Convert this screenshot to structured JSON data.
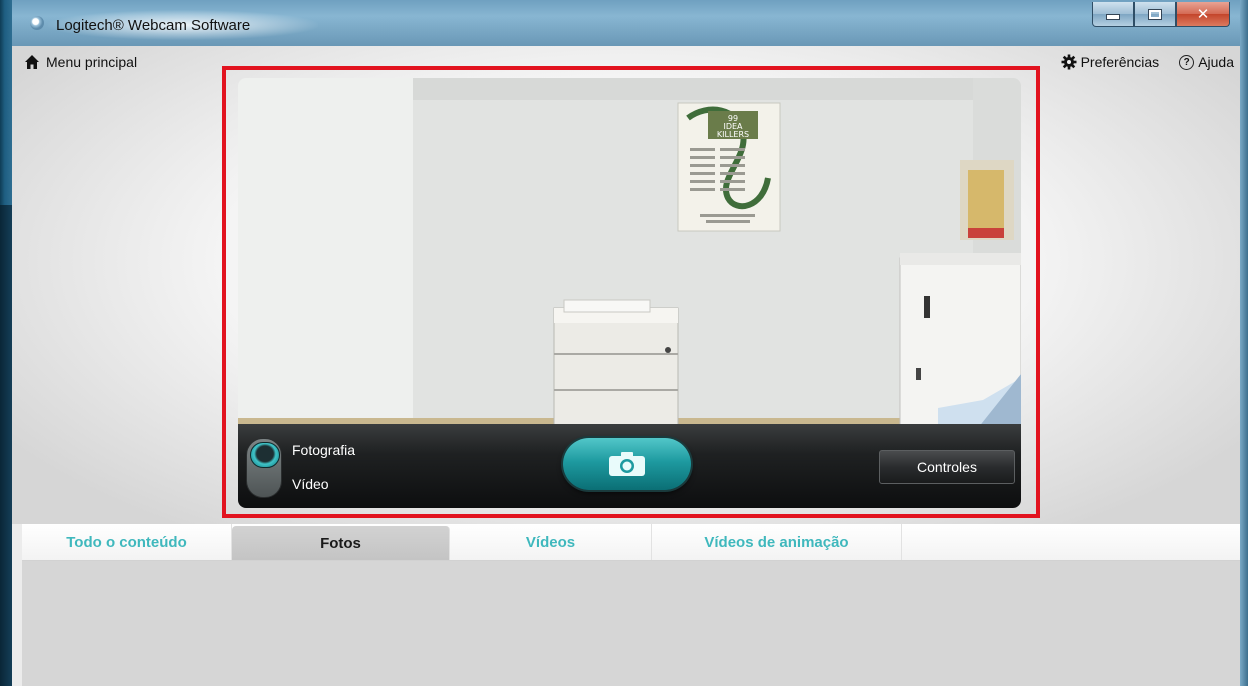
{
  "window": {
    "title": "Logitech® Webcam Software"
  },
  "menu": {
    "home_label": "Menu principal",
    "preferences_label": "Preferências",
    "help_label": "Ajuda"
  },
  "capture": {
    "mode_photo_label": "Fotografia",
    "mode_video_label": "Vídeo",
    "selected_mode": "Fotografia",
    "controls_label": "Controles"
  },
  "poster": {
    "headline_line1": "99",
    "headline_line2": "IDEA",
    "headline_line3": "KILLERS"
  },
  "tabs": [
    {
      "label": "Todo o conteúdo",
      "active": false
    },
    {
      "label": "Fotos",
      "active": true
    },
    {
      "label": "Vídeos",
      "active": false
    },
    {
      "label": "Vídeos de animação",
      "active": false
    }
  ],
  "colors": {
    "accent": "#3fb8bd",
    "highlight_frame": "#e2131f",
    "shutter": "#1e9aa0"
  },
  "icons": {
    "title": "app-icon",
    "home": "home-icon",
    "preferences": "gear-icon",
    "help": "help-icon",
    "shutter": "camera-icon"
  }
}
